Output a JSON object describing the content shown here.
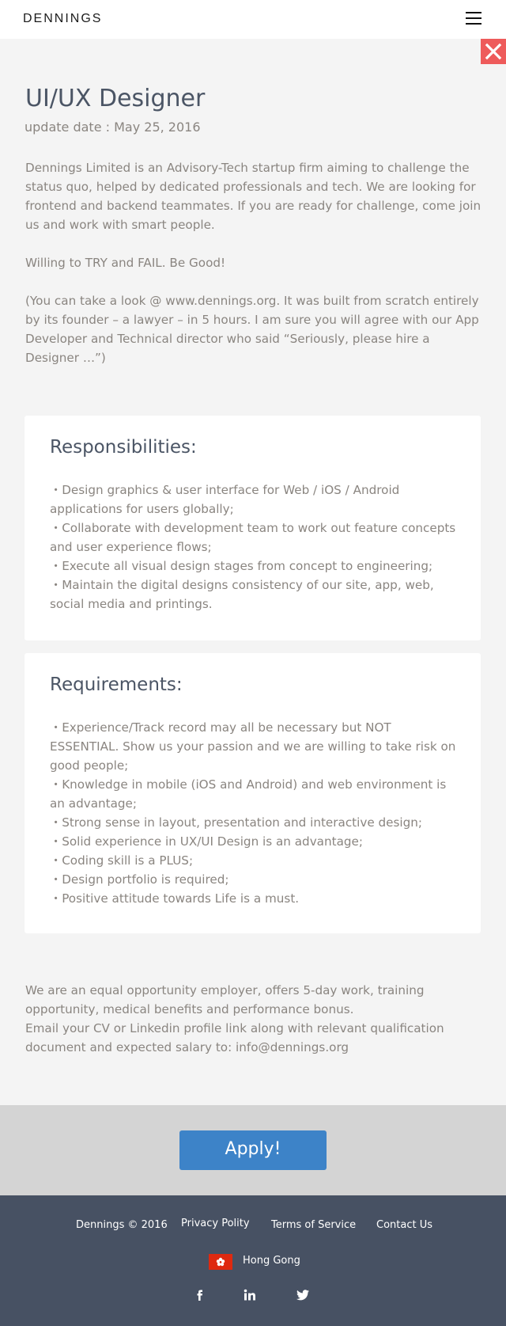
{
  "header": {
    "brand": "DENNINGS"
  },
  "job": {
    "title": "UI/UX Designer",
    "update_date": "update date : May 25, 2016",
    "intro": [
      "Dennings Limited is an Advisory-Tech startup firm aiming to challenge the status quo, helped by dedicated professionals and tech. We are looking for frontend and backend teammates. If you are ready for challenge, come join us and work with smart people.",
      "Willing to TRY and FAIL. Be Good!",
      "(You can take a look @ www.dennings.org. It was built from scratch entirely by its founder – a lawyer – in 5 hours. I am sure you will agree with our App Developer and Technical director who said “Seriously, please hire a Designer …”)"
    ]
  },
  "responsibilities": {
    "heading": "Responsibilities:",
    "items": [
      "・Design graphics & user interface for Web / iOS / Android applications for users globally;",
      "・Collaborate with development team to work out feature concepts and user experience flows;",
      "・Execute all visual design stages from concept to engineering;",
      "・Maintain the digital designs consistency of our site, app, web, social media and printings."
    ]
  },
  "requirements": {
    "heading": "Requirements:",
    "items": [
      "・Experience/Track record may all be necessary but NOT ESSENTIAL. Show us your passion and we are willing to take risk on good people;",
      "・Knowledge in mobile (iOS and Android) and web environment is an advantage;",
      "・Strong sense in layout, presentation and interactive design;",
      "・Solid experience in UX/UI Design is an advantage;",
      "・Coding skill is a PLUS;",
      "・Design portfolio is required;",
      "・Positive attitude towards Life is a must."
    ]
  },
  "closing": {
    "line1": "We are an equal opportunity employer, offers 5-day work, training opportunity, medical benefits and performance bonus.",
    "line2": "Email your CV or Linkedin profile link along with relevant qualification document and expected salary to: info@dennings.org"
  },
  "apply": {
    "label": "Apply!"
  },
  "footer": {
    "copyright": "Dennings © 2016",
    "privacy": "Privacy Polity",
    "terms": "Terms of Service",
    "contact": "Contact Us",
    "region": "Hong Gong",
    "social": [
      "facebook-icon",
      "linkedin-icon",
      "twitter-icon"
    ]
  },
  "colors": {
    "accent": "#3d83c8",
    "close": "#ee5b5b",
    "footer_bg": "#475163",
    "heading": "#4b5565"
  }
}
